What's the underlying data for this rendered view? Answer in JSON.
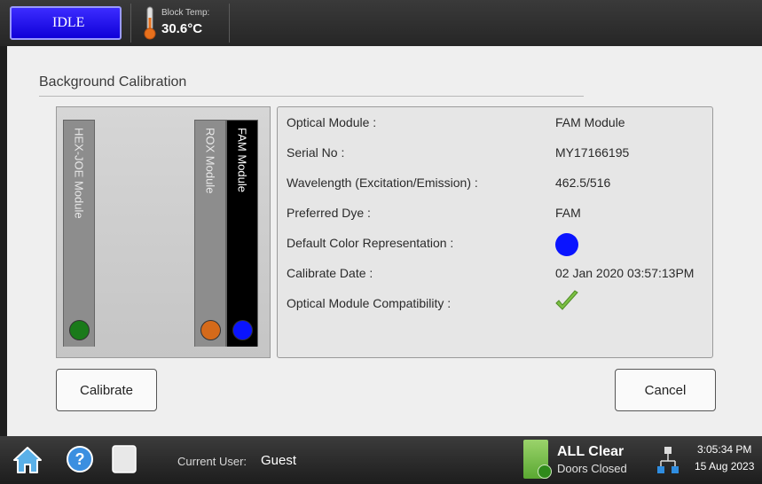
{
  "header": {
    "status_button": "IDLE",
    "block_temp_label": "Block Temp:",
    "block_temp_value": "30.6°C"
  },
  "page": {
    "title": "Background Calibration"
  },
  "modules": [
    {
      "label": "HEX-JOE Module",
      "color": "#1a7a1a"
    },
    {
      "label": "ROX Module",
      "color": "#d56a1a"
    },
    {
      "label": "FAM Module",
      "color": "#0a14ff"
    }
  ],
  "info": {
    "optical_module_label": "Optical Module :",
    "optical_module_value": "FAM Module",
    "serial_label": "Serial No :",
    "serial_value": "MY17166195",
    "wavelength_label": "Wavelength (Excitation/Emission) :",
    "wavelength_value": "462.5/516",
    "preferred_dye_label": "Preferred Dye :",
    "preferred_dye_value": "FAM",
    "default_color_label": "Default Color Representation :",
    "default_color_value": "#0a14ff",
    "calibrate_date_label": "Calibrate Date :",
    "calibrate_date_value": "02 Jan 2020 03:57:13PM",
    "compatibility_label": "Optical Module Compatibility :",
    "compatibility_icon": "check-icon"
  },
  "actions": {
    "calibrate": "Calibrate",
    "cancel": "Cancel"
  },
  "taskbar": {
    "current_user_label": "Current User:",
    "current_user_value": "Guest",
    "status_main": "ALL Clear",
    "status_sub": "Doors Closed",
    "time": "3:05:34 PM",
    "date": "15 Aug 2023",
    "icons": [
      "home-icon",
      "help-icon",
      "document-icon",
      "door-icon",
      "network-icon"
    ]
  }
}
